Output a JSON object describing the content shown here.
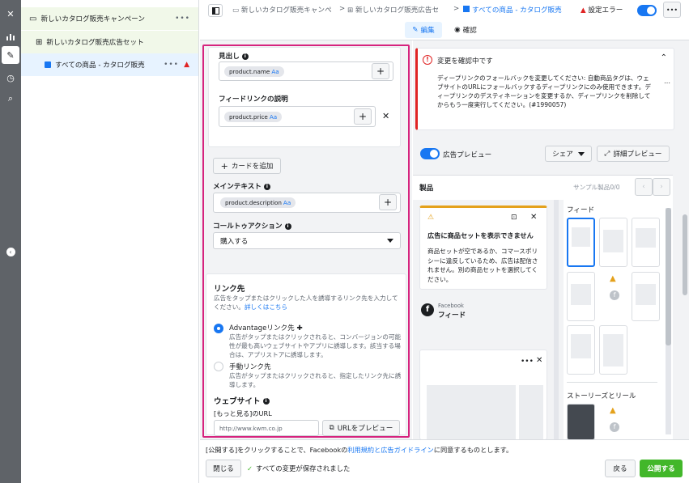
{
  "colors": {
    "accent": "#1877f2",
    "highlight": "#d6237e",
    "error": "#e02424",
    "publish": "#42b72a",
    "warning": "#e4a11b"
  },
  "rail": {
    "icons": [
      "close-icon",
      "chart-icon",
      "pencil-icon",
      "clock-icon",
      "search-icon",
      "collapse-icon"
    ]
  },
  "tree": {
    "campaign": "新しいカタログ販売キャンペーン",
    "adset": "新しいカタログ販売広告セット",
    "ad": "すべての商品 - カタログ販売",
    "more": "•••"
  },
  "header": {
    "crumb1": "新しいカタログ販売キャンペ",
    "crumb2": "新しいカタログ販売広告セ",
    "crumb3": "すべての商品 - カタログ販売",
    "sep": ">",
    "error": "設定エラー",
    "edit": "編集",
    "review": "確認",
    "more": "•••"
  },
  "left": {
    "headline_label": "見出し",
    "headline_chip": "product.name",
    "aa": "Aa",
    "feed_desc_label": "フィードリンクの説明",
    "feed_desc_chip": "product.price",
    "add_card": "カードを追加",
    "main_text_label": "メインテキスト",
    "main_text_chip": "product.description",
    "cta_label": "コールトゥアクション",
    "cta_value": "購入する",
    "link_title": "リンク先",
    "link_desc": "広告をタップまたはクリックした人を誘導するリンク先を入力してください。",
    "learn_more": "詳しくはこちら",
    "opt1_title": "Advantageリンク先",
    "opt1_desc": "広告がタップまたはクリックされると、コンバージョンの可能性が最も高いウェブサイトやアプリに誘導します。該当する場合は、アプリストアに誘導します。",
    "opt2_title": "手動リンク先",
    "opt2_desc": "広告がタップまたはクリックされると、指定したリンク先に誘導します。",
    "website_label": "ウェブサイト",
    "see_more_label": "[もっと見る]のURL",
    "url_value": "http://www.kwm.co.jp",
    "preview_url": "URLをプレビュー"
  },
  "right": {
    "alert_title": "変更を確認中です",
    "alert_body": "ディープリンクのフォールバックを変更してください: 自動商品タグは、ウェブサイトのURLにフォールバックするディープリンクにのみ使用できます。ディープリンクのデスティネーションを変更するか、ディープリンクを削除してからもう一度実行してください。(#1990057)",
    "ad_preview": "広告プレビュー",
    "share": "シェア",
    "detail_preview": "詳細プレビュー",
    "product": "製品",
    "sample": "サンプル製品0/0",
    "err_title": "広告に商品セットを表示できません",
    "err_body": "商品セットが空であるか、コマースポリシーに違反しているため、広告は配信されません。別の商品セットを選択してください。",
    "fb": "Facebook",
    "feed": "フィード",
    "feed_heading": "フィード",
    "stories_heading": "ストーリーズとリール"
  },
  "footer": {
    "terms_pre": "[公開する]をクリックすることで、Facebookの",
    "terms_link": "利用規約と広告ガイドライン",
    "terms_post": "に同意するものとします。",
    "close": "閉じる",
    "saved": "すべての変更が保存されました",
    "back": "戻る",
    "publish": "公開する"
  }
}
